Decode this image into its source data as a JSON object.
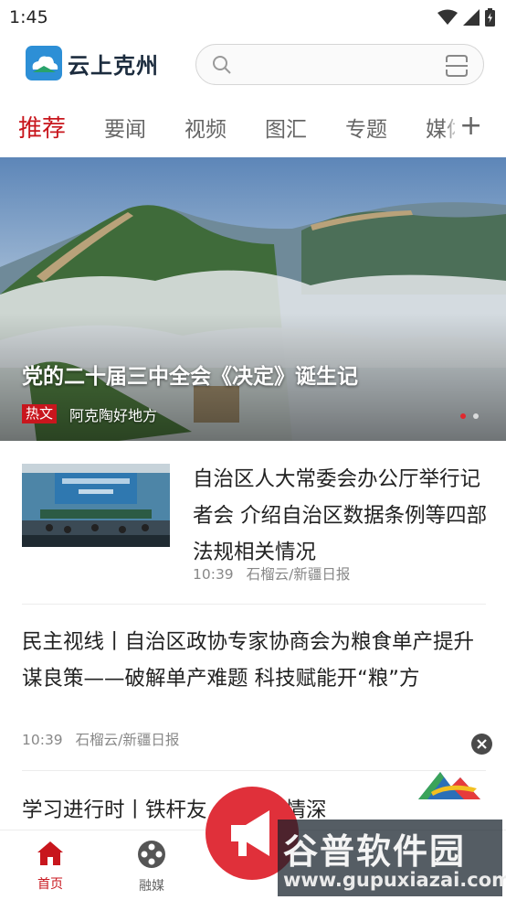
{
  "status_bar": {
    "time": "1:45"
  },
  "header": {
    "app_name": "云上克州",
    "search": {
      "placeholder": ""
    }
  },
  "tabs": [
    {
      "label": "推荐",
      "active": true
    },
    {
      "label": "要闻"
    },
    {
      "label": "视频"
    },
    {
      "label": "图汇"
    },
    {
      "label": "专题"
    },
    {
      "label": "媒体"
    }
  ],
  "tab_add_label": "+",
  "banner": {
    "title": "党的二十届三中全会《决定》诞生记",
    "tag": "热文",
    "source": "阿克陶好地方",
    "page_count": 2,
    "current_page": 1
  },
  "news": [
    {
      "title": "自治区人大常委会办公厅举行记者会 介绍自治区数据条例等四部法规相关情况",
      "time": "10:39",
      "source": "石榴云/新疆日报",
      "has_thumbnail": true
    },
    {
      "title": "民主视线丨自治区政协专家协商会为粮食单产提升谋良策——破解单产难题 科技赋能开“粮”方",
      "time": "10:39",
      "source": "石榴云/新疆日报"
    },
    {
      "title": "学习进行时丨铁杆友"
    },
    {
      "title_tail": "情深"
    }
  ],
  "bottom_nav": [
    {
      "label": "首页",
      "active": true,
      "icon": "home-icon"
    },
    {
      "label": "融媒",
      "icon": "film-reel-icon"
    }
  ],
  "watermark": {
    "text": "谷普软件园",
    "url": "www.gupuxiazai.com"
  },
  "colors": {
    "accent": "#c8161d",
    "text": "#222222",
    "muted": "#888888"
  }
}
